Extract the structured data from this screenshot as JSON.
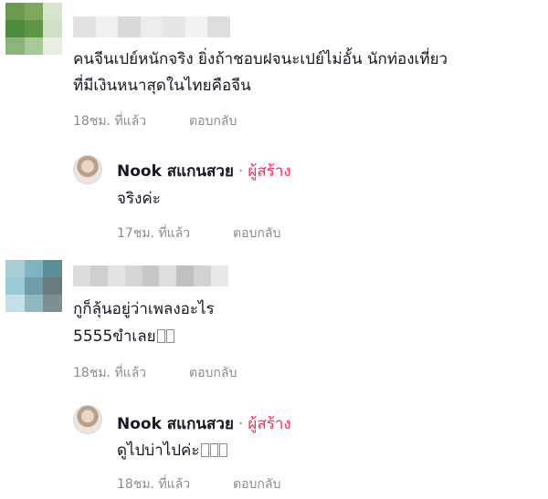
{
  "comments": [
    {
      "text_lines": [
        "คนจีนเปย์หนักจริง ยิ่งถ้าชอบฝจนะเปย์ไม่อั้น นักท่องเที่ยว",
        "ที่มีเงินหนาสุดในไทยคือจีน"
      ],
      "time": "18ชม. ที่แล้ว",
      "reply_label": "ตอบกลับ",
      "avatar_colors": [
        "#6b9a4e",
        "#7fa85f",
        "#d7e5cf",
        "#4e8a3c",
        "#5f9546",
        "#cfe0c6",
        "#8bb578",
        "#a9c99a",
        "#e6efe1"
      ],
      "name_blur_colors": [
        "#e2e2e2",
        "#f0f0f0",
        "#d9d9d9",
        "#ececec",
        "#e6e6e6",
        "#f3f3f3",
        "#dddddd"
      ],
      "reply": {
        "author": "Nook สแกนสวย",
        "separator": "·",
        "badge": "ผู้สร้าง",
        "text": "จริงค่ะ",
        "time": "17ชม. ที่แล้ว",
        "reply_label": "ตอบกลับ"
      }
    },
    {
      "text_lines": [
        "กูก็ลุ้นอยู่ว่าเพลงอะไร",
        "5555ขำเลย"
      ],
      "time": "18ชม. ที่แล้ว",
      "reply_label": "ตอบกลับ",
      "avatar_colors": [
        "#a8cdd6",
        "#7fb3bf",
        "#5d8d99",
        "#9ccad4",
        "#6f9ea9",
        "#6c7a7e",
        "#c4e0e6",
        "#8fb8c0",
        "#7d8f93"
      ],
      "name_blur_colors": [
        "#dcdcdc",
        "#cfcfcf",
        "#e4e4e4",
        "#d6d6d6",
        "#c8c8c8",
        "#dedede",
        "#bfbfbf",
        "#d2d2d2",
        "#e8e8e8"
      ],
      "reply": {
        "author": "Nook สแกนสวย",
        "separator": "·",
        "badge": "ผู้สร้าง",
        "text": "ดูไปบ่าไปค่ะ",
        "time": "18ชม. ที่แล้ว",
        "reply_label": "ตอบกลับ"
      }
    }
  ],
  "colors": {
    "text": "#161823",
    "meta": "#8a8b91",
    "creator_badge": "#fe2c55"
  }
}
